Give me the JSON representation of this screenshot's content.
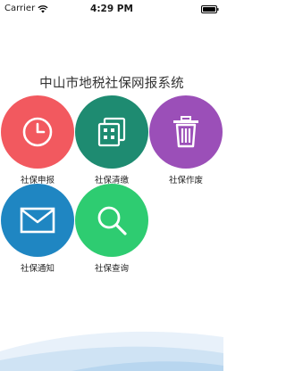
{
  "status_bar": {
    "carrier": "Carrier",
    "time": "4:29 PM"
  },
  "app_title": "中山市地税社保网报系统",
  "tiles": [
    {
      "label": "社保申报",
      "icon": "clock-icon",
      "color": "#f2595f"
    },
    {
      "label": "社保清缴",
      "icon": "calculator-icon",
      "color": "#1e8b71"
    },
    {
      "label": "社保作废",
      "icon": "trash-icon",
      "color": "#9b4fb8"
    },
    {
      "label": "社保通知",
      "icon": "envelope-icon",
      "color": "#1f86c2"
    },
    {
      "label": "社保查询",
      "icon": "search-icon",
      "color": "#2ecc71"
    }
  ]
}
